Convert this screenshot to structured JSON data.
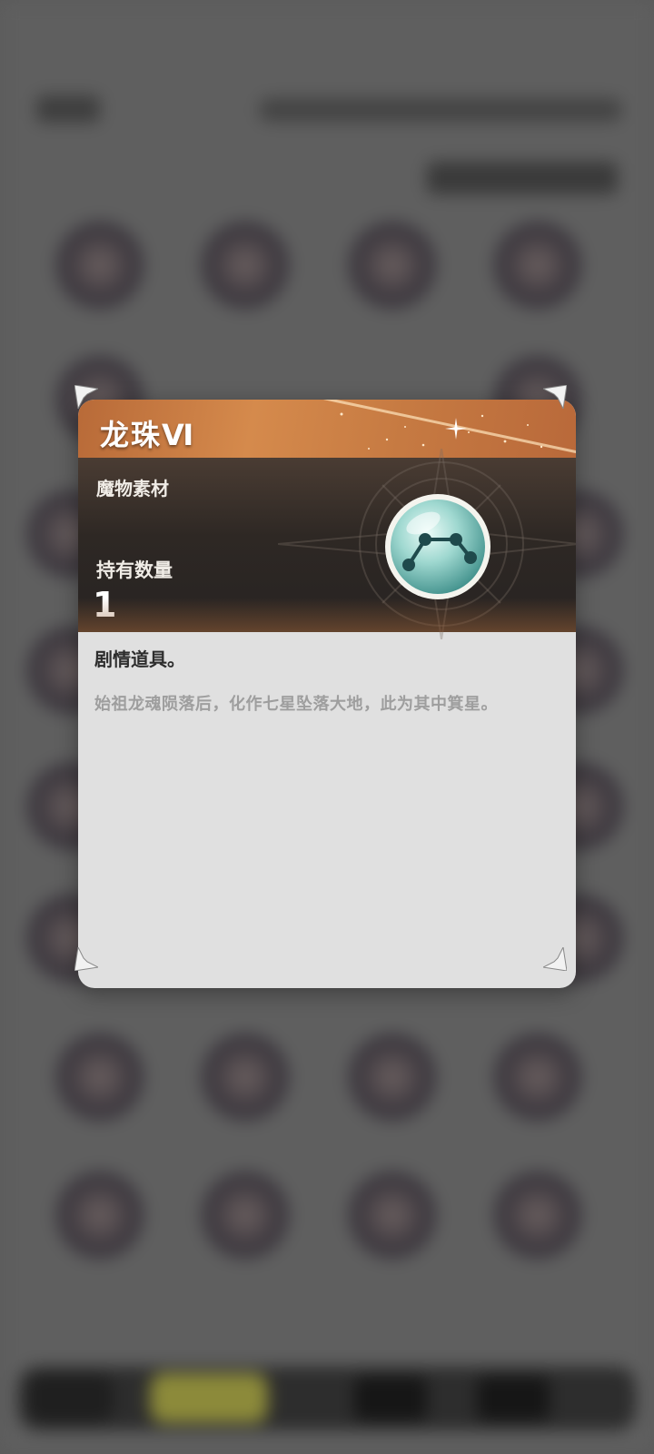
{
  "item": {
    "name": "龙珠Ⅵ",
    "category": "魔物素材",
    "hold_label": "持有数量",
    "hold_count": "1",
    "desc_title": "剧情道具。",
    "desc_body": "始祖龙魂陨落后，化作七星坠落大地，此为其中箕星。"
  },
  "colors": {
    "header": "#d58a4c",
    "info_bg": "#2e2824",
    "panel_bg": "#e0e0e0",
    "orb": "#9fd8d0"
  }
}
